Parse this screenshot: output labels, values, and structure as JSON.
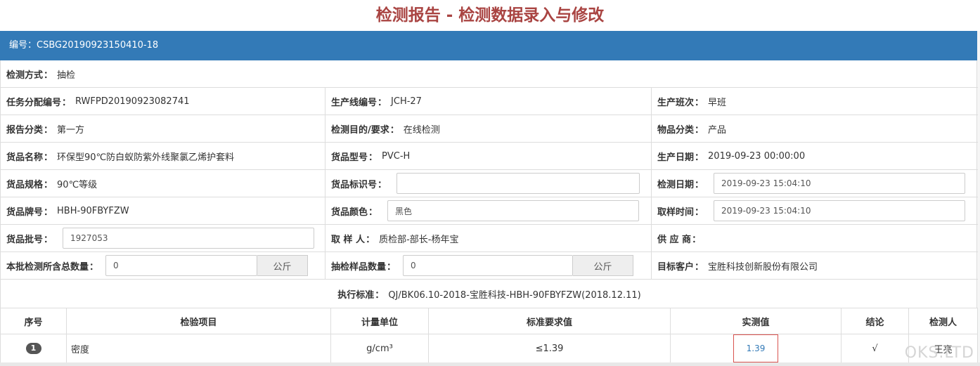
{
  "page": {
    "title": "检测报告 - 检测数据录入与修改"
  },
  "report": {
    "id_label": "编号：",
    "id_value": "CSBG20190923150410-18"
  },
  "form": {
    "method": {
      "label": "检测方式",
      "value": "抽检"
    },
    "task_no": {
      "label": "任务分配编号",
      "value": "RWFPD20190923082741"
    },
    "line_no": {
      "label": "生产线编号",
      "value": "JCH-27"
    },
    "shift": {
      "label": "生产班次",
      "value": "早班"
    },
    "report_type": {
      "label": "报告分类",
      "value": "第一方"
    },
    "purpose": {
      "label": "检测目的/要求",
      "value": "在线检测"
    },
    "item_type": {
      "label": "物品分类",
      "value": "产品"
    },
    "goods_name": {
      "label": "货品名称",
      "value": "环保型90℃防白蚁防紫外线聚氯乙烯护套料"
    },
    "goods_model": {
      "label": "货品型号",
      "value": "PVC-H"
    },
    "prod_date": {
      "label": "生产日期",
      "value": "2019-09-23 00:00:00"
    },
    "goods_spec": {
      "label": "货品规格",
      "value": "90℃等级"
    },
    "goods_mark": {
      "label": "货品标识号",
      "value": ""
    },
    "test_date": {
      "label": "检测日期",
      "value": "2019-09-23 15:04:10"
    },
    "goods_brand": {
      "label": "货品牌号",
      "value": "HBH-90FBYFZW"
    },
    "goods_color": {
      "label": "货品颜色",
      "value": "黑色"
    },
    "sample_time": {
      "label": "取样时间",
      "value": "2019-09-23 15:04:10"
    },
    "batch_no": {
      "label": "货品批号",
      "value": "1927053"
    },
    "sampler": {
      "label": "取 样 人",
      "value": "质检部-部长-杨年宝"
    },
    "supplier": {
      "label": "供 应 商",
      "value": ""
    },
    "total_qty": {
      "label": "本批检测所含总数量",
      "value": "0",
      "unit": "公斤"
    },
    "sample_qty": {
      "label": "抽检样品数量",
      "value": "0",
      "unit": "公斤"
    },
    "customer": {
      "label": "目标客户",
      "value": "宝胜科技创新股份有限公司"
    },
    "standard": {
      "label": "执行标准",
      "value": "QJ/BK06.10-2018-宝胜科技-HBH-90FBYFZW(2018.12.11)"
    }
  },
  "table": {
    "headers": {
      "seq": "序号",
      "item": "检验项目",
      "unit": "计量单位",
      "standard": "标准要求值",
      "measured": "实测值",
      "conclusion": "结论",
      "tester": "检测人"
    },
    "rows": [
      {
        "seq": "1",
        "item": "密度",
        "unit": "g/cm³",
        "standard": "≤1.39",
        "measured": "1.39",
        "conclusion": "√",
        "tester": "王亮"
      }
    ]
  },
  "watermark": "OKS.LTD",
  "colors": {
    "title": "#a94442",
    "header_bar": "#337ab7",
    "highlight_border": "#d9534f"
  }
}
